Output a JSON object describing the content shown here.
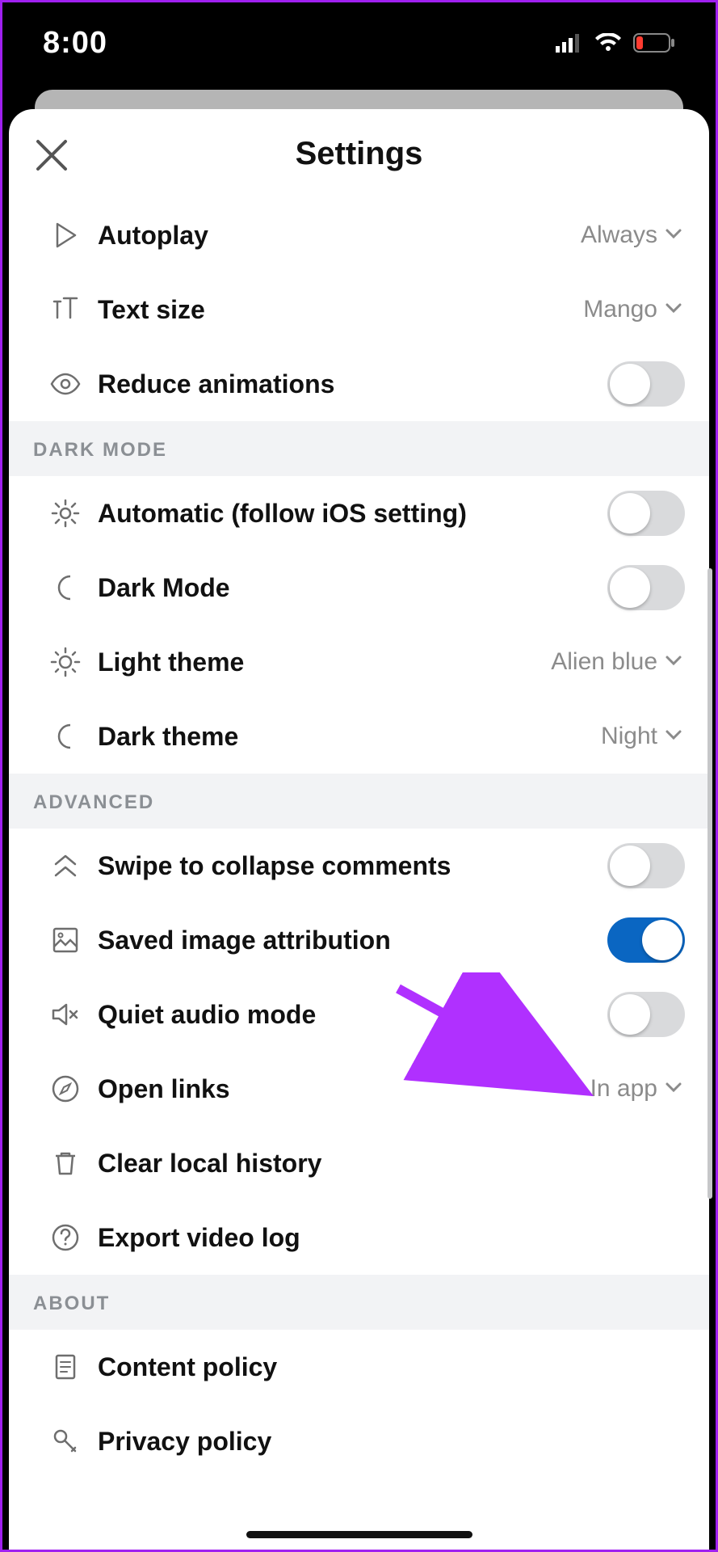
{
  "statusbar": {
    "time": "8:00"
  },
  "header": {
    "title": "Settings"
  },
  "rows": {
    "autoplay": {
      "label": "Autoplay",
      "value": "Always"
    },
    "textsize": {
      "label": "Text size",
      "value": "Mango"
    },
    "reduceanim": {
      "label": "Reduce animations"
    },
    "auto_ios": {
      "label": "Automatic (follow iOS setting)"
    },
    "darkmode": {
      "label": "Dark Mode"
    },
    "lighttheme": {
      "label": "Light theme",
      "value": "Alien blue"
    },
    "darktheme": {
      "label": "Dark theme",
      "value": "Night"
    },
    "swipe": {
      "label": "Swipe to collapse comments"
    },
    "savedimg": {
      "label": "Saved image attribution"
    },
    "quiet": {
      "label": "Quiet audio mode"
    },
    "openlinks": {
      "label": "Open links",
      "value": "In app"
    },
    "clearhist": {
      "label": "Clear local history"
    },
    "exportvid": {
      "label": "Export video log"
    },
    "content": {
      "label": "Content policy"
    },
    "privacy": {
      "label": "Privacy policy"
    }
  },
  "sections": {
    "darkmode": "DARK MODE",
    "advanced": "ADVANCED",
    "about": "ABOUT"
  },
  "toggles": {
    "reduceanim": false,
    "auto_ios": false,
    "darkmode": false,
    "swipe": false,
    "savedimg": true,
    "quiet": false
  }
}
